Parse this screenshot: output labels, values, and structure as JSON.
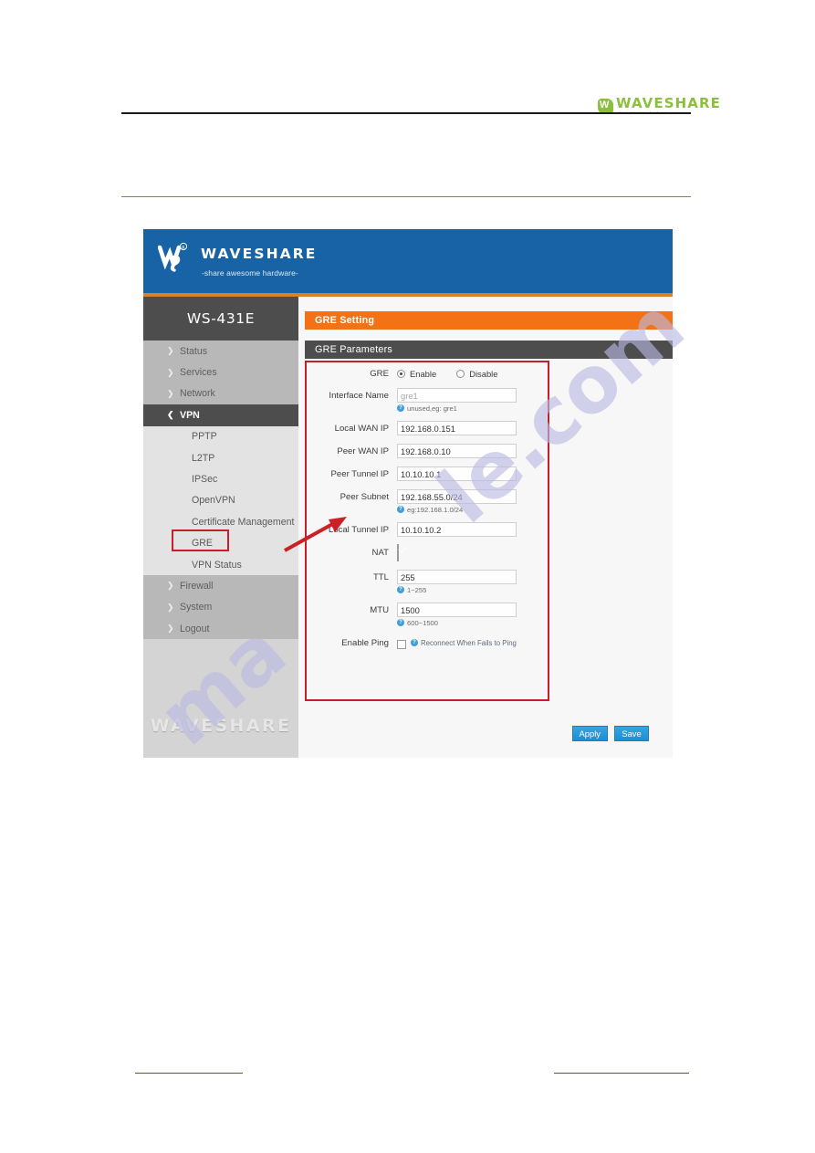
{
  "document": {
    "logo": {
      "name": "WAVESHARE",
      "tagline": "-share awesome hardware-",
      "mark_icon": "waveshare-logo-icon",
      "color": "#8cbf3f"
    }
  },
  "screenshot": {
    "header": {
      "brand_name": "WAVESHARE",
      "brand_tagline": "-share awesome hardware-",
      "logo_icon": "waveshare-logo-icon",
      "background": "#1763a6",
      "accent": "#d98124"
    },
    "sidebar": {
      "model": "WS-431E",
      "watermark": "WAVESHARE",
      "top_items": [
        {
          "label": "Status",
          "icon": "chevron-right-icon"
        },
        {
          "label": "Services",
          "icon": "chevron-right-icon"
        },
        {
          "label": "Network",
          "icon": "chevron-right-icon"
        },
        {
          "label": "VPN",
          "icon": "chevron-down-icon",
          "active": true
        }
      ],
      "sub_items": [
        {
          "label": "PPTP"
        },
        {
          "label": "L2TP"
        },
        {
          "label": "IPSec"
        },
        {
          "label": "OpenVPN"
        },
        {
          "label": "Certificate Management"
        },
        {
          "label": "GRE",
          "highlighted": true
        },
        {
          "label": "VPN Status"
        }
      ],
      "bottom_items": [
        {
          "label": "Firewall",
          "icon": "chevron-right-icon"
        },
        {
          "label": "System",
          "icon": "chevron-right-icon"
        },
        {
          "label": "Logout",
          "icon": "chevron-right-icon"
        }
      ]
    },
    "content": {
      "page_bar": {
        "title": "GRE Setting",
        "color": "#f47216"
      },
      "section_bar": {
        "title": "GRE Parameters",
        "color": "#4d4d4d"
      },
      "fields": {
        "gre": {
          "label": "GRE",
          "options": [
            {
              "label": "Enable",
              "selected": true
            },
            {
              "label": "Disable",
              "selected": false
            }
          ]
        },
        "interface_name": {
          "label": "Interface Name",
          "value": "gre1",
          "is_placeholder": true,
          "hint": "unused,eg: gre1",
          "hint_icon": "help-icon"
        },
        "local_wan_ip": {
          "label": "Local WAN IP",
          "value": "192.168.0.151"
        },
        "peer_wan_ip": {
          "label": "Peer WAN IP",
          "value": "192.168.0.10"
        },
        "peer_tunnel_ip": {
          "label": "Peer Tunnel IP",
          "value": "10.10.10.1"
        },
        "peer_subnet": {
          "label": "Peer Subnet",
          "value": "192.168.55.0/24",
          "hint": "eg:192.168.1.0/24",
          "hint_icon": "help-icon"
        },
        "local_tunnel_ip": {
          "label": "Local Tunnel IP",
          "value": "10.10.10.2"
        },
        "nat": {
          "label": "NAT",
          "checked": true
        },
        "ttl": {
          "label": "TTL",
          "value": "255",
          "hint": "1~255",
          "hint_icon": "help-icon"
        },
        "mtu": {
          "label": "MTU",
          "value": "1500",
          "hint": "600~1500",
          "hint_icon": "help-icon"
        },
        "enable_ping": {
          "label": "Enable Ping",
          "checked": false,
          "hint": "Reconnect When Fails to Ping",
          "hint_icon": "help-icon"
        }
      },
      "buttons": {
        "apply": "Apply",
        "save": "Save",
        "color": "#1b8fd4"
      }
    },
    "annotation": {
      "arrow_icon": "red-arrow-right-icon",
      "highlight_color": "#c52029"
    }
  },
  "watermarks": {
    "line_a": "ma",
    "line_b": "le.com"
  }
}
